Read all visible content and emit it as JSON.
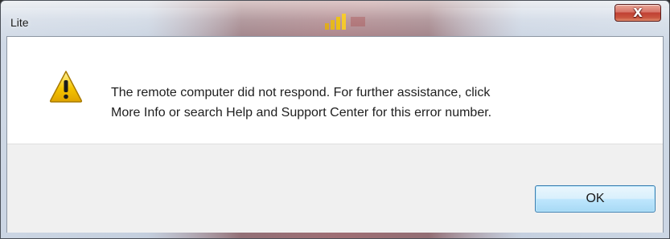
{
  "window": {
    "title": "Lite"
  },
  "titlebar": {
    "close_icon_glyph": "X"
  },
  "dialog": {
    "icon": "warning-icon",
    "message_line_1": "The remote computer did not respond.  For further assistance, click",
    "message_line_2": "More Info or search Help and Support Center for this error number.",
    "ok_label": "OK"
  },
  "colors": {
    "close_button": "#c9553f",
    "ok_button_border": "#3c7fb1",
    "footer_bg": "#f0f0f0",
    "warning_fill": "#f5c400"
  }
}
